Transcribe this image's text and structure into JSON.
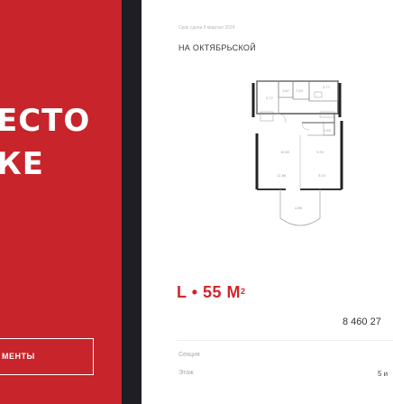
{
  "hero": {
    "line1": "ЕСТО",
    "line2": "КЕ",
    "cta_label": "МЕНТЫ"
  },
  "card": {
    "deadline": "Срок сдачи II квартал 2024",
    "complex_name": "НА ОКТЯБРЬСКОЙ",
    "apartment_type": {
      "prefix": "L",
      "size": "55 М",
      "superscript": "2"
    },
    "price": "8 460 27",
    "section_label": "Секция",
    "floor_label": "Этаж",
    "floor_value": "5 и"
  },
  "plan": {
    "rooms": [
      "5.72",
      "1.67",
      "7.03",
      "4.77",
      "10.63",
      "2.60",
      "5.90",
      "12.86",
      "3.03",
      "4.86"
    ]
  },
  "colors": {
    "brand_red": "#c8242b",
    "accent_red": "#d4242b",
    "dark_strip": "#1e1e24"
  }
}
